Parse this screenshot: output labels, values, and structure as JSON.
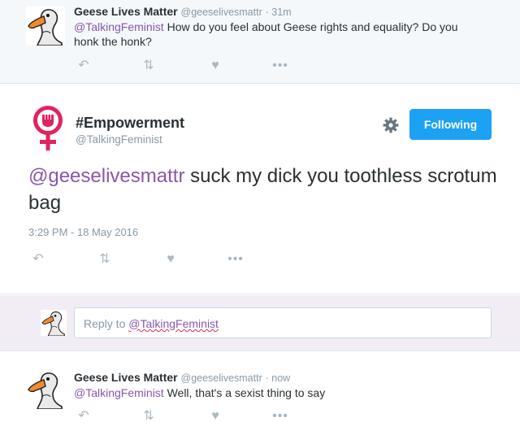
{
  "top_tweet": {
    "display_name": "Geese Lives Matter",
    "screen_name": "@geeselivesmattr",
    "time": "· 31m",
    "mention": "@TalkingFeminist",
    "text": " How do you feel about Geese rights and equality? Do you honk the honk?"
  },
  "main_tweet": {
    "display_name": "#Empowerment",
    "screen_name": "@TalkingFeminist",
    "follow_label": "Following",
    "mention": "@geeselivesmattr",
    "text": " suck my dick you toothless scrotum bag",
    "timestamp": "3:29 PM - 18 May 2016"
  },
  "reply": {
    "prefix": "Reply to ",
    "mention": "@TalkingFeminist"
  },
  "bottom_tweet": {
    "display_name": "Geese Lives Matter",
    "screen_name": "@geeselivesmattr",
    "time": "· now",
    "mention": "@TalkingFeminist",
    "text": " Well, that's a sexist thing to say"
  },
  "colors": {
    "brand_blue": "#1da1f2",
    "mention_purple": "#8956ac",
    "feminist_pink": "#e0245e",
    "muted": "#8899a6"
  },
  "icons": {
    "reply": "reply-icon",
    "retweet": "retweet-icon",
    "like": "heart-icon",
    "more": "more-icon",
    "settings": "gear-icon"
  }
}
